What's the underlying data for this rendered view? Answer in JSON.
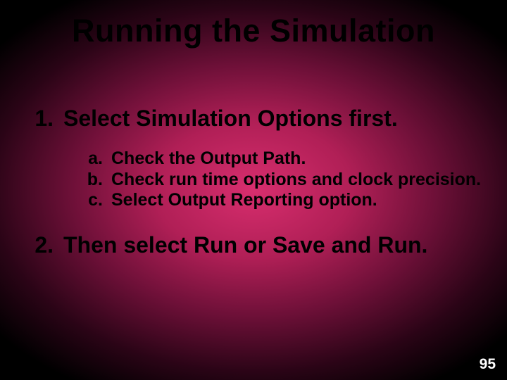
{
  "title": "Running the Simulation",
  "steps": {
    "one": {
      "marker": "1.",
      "text": "Select Simulation Options first.",
      "sub": {
        "a": {
          "marker": "a.",
          "text": "Check the Output Path."
        },
        "b": {
          "marker": "b.",
          "text": "Check run time options and clock precision."
        },
        "c": {
          "marker": "c.",
          "text": "Select Output Reporting option."
        }
      }
    },
    "two": {
      "marker": "2.",
      "text": "Then select Run or Save and Run."
    }
  },
  "page_number": "95"
}
